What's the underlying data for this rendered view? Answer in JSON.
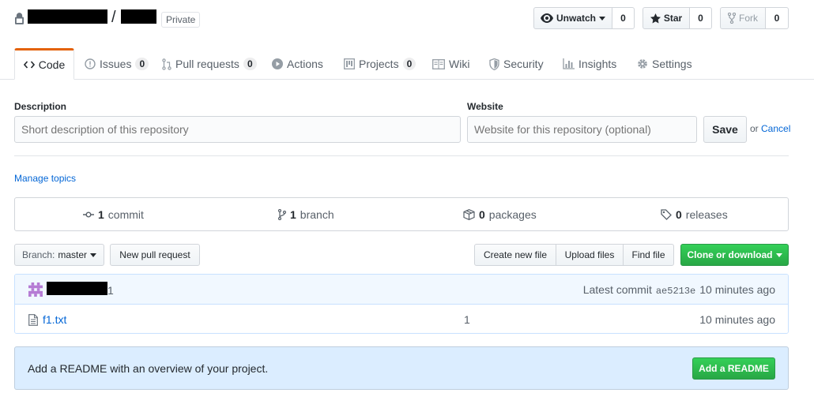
{
  "repo": {
    "visibility": "Private",
    "separator": "/"
  },
  "header_actions": {
    "unwatch_label": "Unwatch",
    "unwatch_count": "0",
    "star_label": "Star",
    "star_count": "0",
    "fork_label": "Fork",
    "fork_count": "0"
  },
  "tabs": [
    {
      "label": "Code",
      "count": ""
    },
    {
      "label": "Issues",
      "count": "0"
    },
    {
      "label": "Pull requests",
      "count": "0"
    },
    {
      "label": "Actions",
      "count": ""
    },
    {
      "label": "Projects",
      "count": "0"
    },
    {
      "label": "Wiki",
      "count": ""
    },
    {
      "label": "Security",
      "count": ""
    },
    {
      "label": "Insights",
      "count": ""
    },
    {
      "label": "Settings",
      "count": ""
    }
  ],
  "about": {
    "description_label": "Description",
    "description_placeholder": "Short description of this repository",
    "website_label": "Website",
    "website_placeholder": "Website for this repository (optional)",
    "save_label": "Save",
    "or_text": "or",
    "cancel_label": "Cancel",
    "manage_topics": "Manage topics"
  },
  "stats": {
    "commits_num": "1",
    "commits_label": "commit",
    "branches_num": "1",
    "branches_label": "branch",
    "packages_num": "0",
    "packages_label": "packages",
    "releases_num": "0",
    "releases_label": "releases"
  },
  "file_nav": {
    "branch_prefix": "Branch:",
    "branch_name": "master",
    "new_pr_label": "New pull request",
    "create_file_label": "Create new file",
    "upload_files_label": "Upload files",
    "find_file_label": "Find file",
    "clone_label": "Clone or download"
  },
  "commit": {
    "message": "1",
    "latest_label": "Latest commit",
    "sha": "ae5213e",
    "time": "10 minutes ago"
  },
  "files": [
    {
      "name": "f1.txt",
      "message": "1",
      "age": "10 minutes ago"
    }
  ],
  "readme_prompt": {
    "text": "Add a README with an overview of your project.",
    "button_label": "Add a README"
  },
  "colors": {
    "accent_orange": "#e36209",
    "link_blue": "#0366d6",
    "green_button": "#2cbe4e",
    "commit_bar": "#f1f8ff"
  }
}
